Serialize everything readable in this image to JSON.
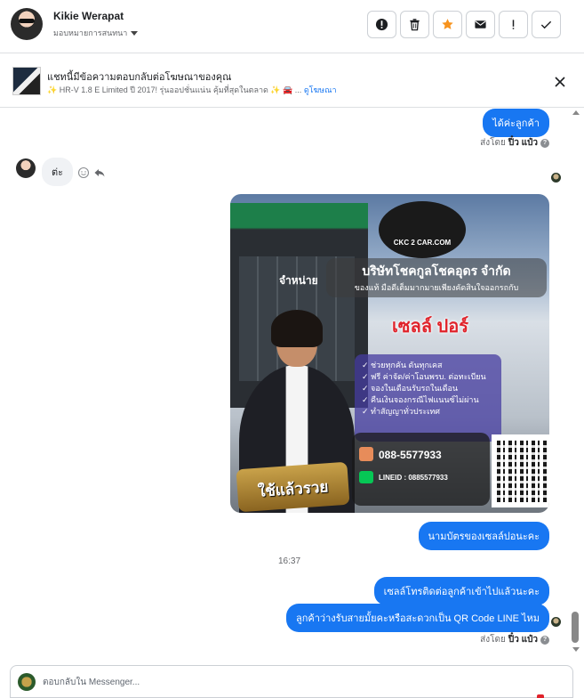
{
  "header": {
    "contact_name": "Kikie Werapat",
    "assign_label": "มอบหมายการสนทนา",
    "buttons": [
      {
        "name": "spam-button",
        "icon": "alert-circle-icon"
      },
      {
        "name": "delete-button",
        "icon": "trash-icon"
      },
      {
        "name": "star-button",
        "icon": "star-icon",
        "color": "#f7931e"
      },
      {
        "name": "email-button",
        "icon": "envelope-icon"
      },
      {
        "name": "follow-up-button",
        "icon": "exclamation-icon"
      },
      {
        "name": "done-button",
        "icon": "checkmark-icon"
      }
    ]
  },
  "ad_banner": {
    "title": "แชทนี้มีข้อความตอบกลับต่อโฆษณาของคุณ",
    "subtitle": "✨ HR-V 1.8 E Limited ปี 2017! รุ่นออปชั่นแน่น คุ้มที่สุดในตลาด ✨ 🚘 ...",
    "link": "ดูโฆษณา"
  },
  "messages": {
    "out_1": "ได้ค่ะลูกค้า",
    "sent_by_prefix": "ส่งโดย",
    "sent_by_name": "ปิ๋ว แป๋ว",
    "in_1": "ต่ะ",
    "image_caption": "นามบัตรของเซลล์ปอนะคะ",
    "timestamp": "16:37",
    "out_2": "เซลล์โทรติดต่อลูกค้าเข้าไปแล้วนะคะ",
    "out_3": "ลูกค้าว่างรับสายมั้ยคะหรือสะดวกเป็น QR Code LINE ไหม"
  },
  "business_card": {
    "logo_text": "CKC 2 CAR.COM",
    "company": "บริษัทโชคกูลโชคอุดร จำกัด",
    "slogan_line": "ของแท้ มือดีเต็มมากมายเพียงคัดสินใจออกรถกับ",
    "shop_sign": "จำหน่าย",
    "sales_name": "เซลล์ ปอร์",
    "bullets": [
      "✓ ช่วยทุกคัน ดันทุกเคส",
      "✓ ฟรี ค่าจัด/ค่าโอนพรบ. ต่อทะเบียน",
      "✓ จองในเดือนรับรถในเดือน",
      "✓ คืนเงินจองกรณีไฟแนนซ์ไม่ผ่าน",
      "✓ ทำสัญญาทั่วประเทศ"
    ],
    "tagline": "ใช้แล้วรวย",
    "phone": "088-5577933",
    "line_id": "LINEID : 0885577933"
  },
  "compose": {
    "placeholder": "ตอบกลับใน Messenger..."
  },
  "colors": {
    "accent": "#1877f2",
    "star": "#f7931e"
  }
}
